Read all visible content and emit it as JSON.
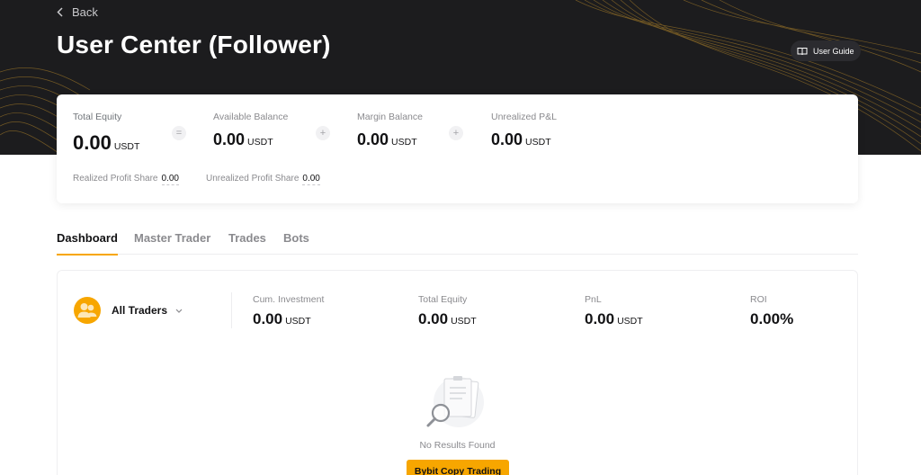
{
  "header": {
    "back_label": "Back",
    "title": "User Center (Follower)",
    "guide_label": "User Guide"
  },
  "summary": {
    "total_equity": {
      "label": "Total Equity",
      "value": "0.00",
      "unit": "USDT"
    },
    "operator_equals": "=",
    "available_balance": {
      "label": "Available Balance",
      "value": "0.00",
      "unit": "USDT"
    },
    "operator_plus_1": "+",
    "margin_balance": {
      "label": "Margin Balance",
      "value": "0.00",
      "unit": "USDT"
    },
    "operator_plus_2": "+",
    "unrealized_pnl": {
      "label": "Unrealized P&L",
      "value": "0.00",
      "unit": "USDT"
    },
    "realized_profit_share": {
      "label": "Realized Profit Share",
      "value": "0.00"
    },
    "unrealized_profit_share": {
      "label": "Unrealized Profit Share",
      "value": "0.00"
    }
  },
  "tabs": [
    {
      "label": "Dashboard",
      "active": true
    },
    {
      "label": "Master Trader",
      "active": false
    },
    {
      "label": "Trades",
      "active": false
    },
    {
      "label": "Bots",
      "active": false
    }
  ],
  "dashboard": {
    "traders_filter": "All Traders",
    "stats": [
      {
        "label": "Cum. Investment",
        "value": "0.00",
        "unit": "USDT"
      },
      {
        "label": "Total Equity",
        "value": "0.00",
        "unit": "USDT"
      },
      {
        "label": "PnL",
        "value": "0.00",
        "unit": "USDT"
      },
      {
        "label": "ROI",
        "value": "0.00%",
        "unit": ""
      }
    ],
    "empty_text": "No Results Found",
    "cta_label": "Bybit Copy Trading"
  },
  "colors": {
    "accent": "#f7a600",
    "hero_bg": "#1c1c1e",
    "text_primary": "#121214",
    "text_secondary": "#8a8a8e"
  },
  "icons": [
    "chevron-left-icon",
    "book-icon",
    "users-icon",
    "chevron-down-icon",
    "document-search-icon"
  ]
}
